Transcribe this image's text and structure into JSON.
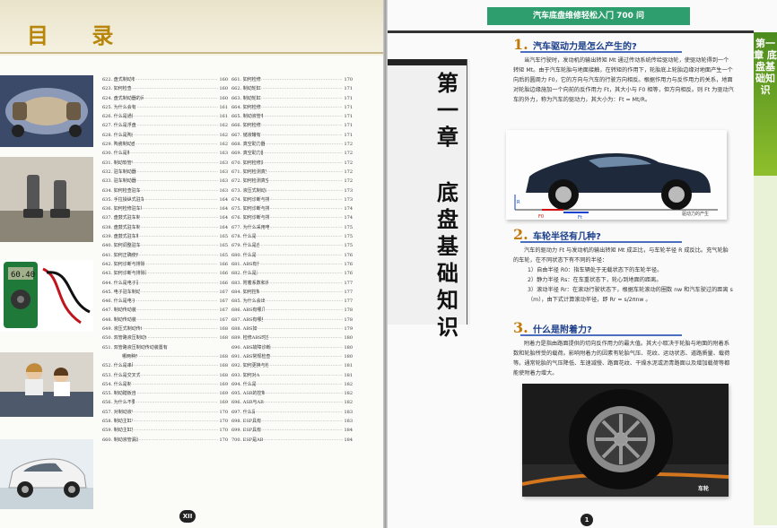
{
  "left_page": {
    "title": "目 录",
    "page_number": "XII",
    "toc_col1": [
      {
        "t": "622. 盘式制动有什么优点？",
        "p": "160"
      },
      {
        "t": "623. 如何检查制动盘？",
        "p": "160"
      },
      {
        "t": "624. 盘式制动器的间隙如何自动调整？",
        "p": "160"
      },
      {
        "t": "625. 为什么会有通风制动盘？",
        "p": "161"
      },
      {
        "t": "626. 什么是通风制动盘？",
        "p": "161"
      },
      {
        "t": "627. 什么是浮盘式制动系统？",
        "p": "162"
      },
      {
        "t": "628. 什么是陶瓷制动盘？",
        "p": "162"
      },
      {
        "t": "629. 陶瓷制动盘有何优势？",
        "p": "162"
      },
      {
        "t": "630. 什么是制动液？",
        "p": "163"
      },
      {
        "t": "631. 制动软管有何作用？",
        "p": "163"
      },
      {
        "t": "632. 驻车制动器有什么作用？",
        "p": "163"
      },
      {
        "t": "633. 驻车制动器有哪些类型？",
        "p": "163"
      },
      {
        "t": "634. 如何检查驻车制动器的性能？",
        "p": "163"
      },
      {
        "t": "635. 手拉操纵式驻车制动器如何工作？",
        "p": "164"
      },
      {
        "t": "636. 如何检修驻车制动器操纵装置？",
        "p": "164"
      },
      {
        "t": "637. 盘鼓式驻车制动器如何工作？",
        "p": "164"
      },
      {
        "t": "638. 盘鼓式驻车制动器如何工作？",
        "p": "164"
      },
      {
        "t": "639. 盘鼓式驻车制动器的结构？",
        "p": "165"
      },
      {
        "t": "640. 如何调整驻车制动器的行程？",
        "p": "165"
      },
      {
        "t": "641. 如何正确使用驻车制动器？",
        "p": "165"
      },
      {
        "t": "642. 如何诊断与排除驻车制动不良故障？",
        "p": "166"
      },
      {
        "t": "643. 如何诊断与排除驻车制动器拖滞故障？",
        "p": "166"
      },
      {
        "t": "644. 什么是电子驻车制动系统？",
        "p": "166"
      },
      {
        "t": "645. 电子驻车制动系统如何工作？",
        "p": "167"
      },
      {
        "t": "646. 什么是电子驻车系统？",
        "p": "167"
      },
      {
        "t": "647. 制动传动装置有何作用？",
        "p": "167"
      },
      {
        "t": "648. 制动传动装置如何分类？",
        "p": "167"
      },
      {
        "t": "649. 液压式制动传动装置有何特点？",
        "p": "168"
      },
      {
        "t": "650. 双管路液压制动传动装置有什么特点？",
        "p": "168"
      },
      {
        "t": "651. 双管路液压制动传动装置有",
        "p": "",
        "nopage": true
      },
      {
        "t": "哪两种形式？",
        "p": "168",
        "sub": true
      },
      {
        "t": "652. 什么是串联式主缸？",
        "p": "168"
      },
      {
        "t": "653. 什么是交叉式制动传动装置？",
        "p": "168"
      },
      {
        "t": "654. 什么是制动踏板？",
        "p": "169"
      },
      {
        "t": "655. 制动踏板自由行程多大？",
        "p": "169"
      },
      {
        "t": "656. 为什么不要空档滑行？",
        "p": "169"
      },
      {
        "t": "657. 对制动液有何要求？",
        "p": "170"
      },
      {
        "t": "658. 制动主缸有何作用？",
        "p": "170"
      },
      {
        "t": "659. 制动主缸如何工作？",
        "p": "170"
      },
      {
        "t": "660. 制动液管漏油时如何处理？",
        "p": "170"
      }
    ],
    "toc_col2": [
      {
        "t": "661. 如何检修制动主缸？",
        "p": "170"
      },
      {
        "t": "662. 制动轮缸有何作用？",
        "p": "171"
      },
      {
        "t": "663. 制动轮缸如何工作？",
        "p": "171"
      },
      {
        "t": "664. 如何检修制动轮缸？",
        "p": "171"
      },
      {
        "t": "665. 制动液管有几种类型？",
        "p": "171"
      },
      {
        "t": "666. 如何检修制动液管？",
        "p": "171"
      },
      {
        "t": "667. 储液罐有什么作用？",
        "p": "171"
      },
      {
        "t": "668. 真空助力器有什么作用？",
        "p": "172"
      },
      {
        "t": "669. 真空助力器怎样工作？",
        "p": "172"
      },
      {
        "t": "670. 如何检修真空助力器？",
        "p": "172"
      },
      {
        "t": "671. 如何检测真空助力器性能？",
        "p": "172"
      },
      {
        "t": "672. 如何检测真空助力器密封性？",
        "p": "172"
      },
      {
        "t": "673. 液压式制动系统如何排气？",
        "p": "173"
      },
      {
        "t": "674. 如何诊断与排除制动不良故障？",
        "p": "173"
      },
      {
        "t": "675. 如何诊断与排除制动跑偏故障？",
        "p": "174"
      },
      {
        "t": "676. 如何诊断与排除制动拖滞故障？",
        "p": "174"
      },
      {
        "t": "677. 为什么采用电动制动助力装置？",
        "p": "175"
      },
      {
        "t": "678. 什么是ABS？",
        "p": "175"
      },
      {
        "t": "679. 什么是自动驻车？",
        "p": "175"
      },
      {
        "t": "680. 什么是ABS？",
        "p": "176"
      },
      {
        "t": "681. ABS有什么优点？",
        "p": "176"
      },
      {
        "t": "682. 什么是滑移率？",
        "p": "176"
      },
      {
        "t": "683. 附着系数和滑移率有何关系？",
        "p": "177"
      },
      {
        "t": "684. 如何控制滑移率？",
        "p": "177"
      },
      {
        "t": "685. 为什么会出现滑移现象？",
        "p": "177"
      },
      {
        "t": "686. ABS有哪几种控制形式？",
        "p": "178"
      },
      {
        "t": "687. ABS有哪些生产厂家？",
        "p": "178"
      },
      {
        "t": "688. ABS如何工作？",
        "p": "179"
      },
      {
        "t": "689. 检修ABS时应注意哪些问题？",
        "p": "180"
      },
      {
        "t": "690. ABS故障诊断的一般程序是什么？",
        "p": "180"
      },
      {
        "t": "691. ABS常规检查包括哪几个方面？",
        "p": "180"
      },
      {
        "t": "692. 如何更换与检查ABS控制器？",
        "p": "181"
      },
      {
        "t": "693. 如何对ABS排气？",
        "p": "181"
      },
      {
        "t": "694. 什么是ASR？",
        "p": "182"
      },
      {
        "t": "695. ASR的控制方式有几种？",
        "p": "182"
      },
      {
        "t": "696. ASR与ABS有何异同？",
        "p": "182"
      },
      {
        "t": "697. 什么是ESP？",
        "p": "183"
      },
      {
        "t": "698. ESP具有哪些功能？",
        "p": "183"
      },
      {
        "t": "699. ESP具有哪些特点？",
        "p": "184"
      },
      {
        "t": "700. ESP是ABS的升级吗？",
        "p": "184"
      }
    ]
  },
  "right_page": {
    "header_band": "汽车底盘维修轻松入门 700 问",
    "chapter_no": "第一章",
    "chapter_name": "底盘基础知识",
    "side_tab": "第一章 底盘基础知识",
    "page_number": "1",
    "sections": [
      {
        "num": "1.",
        "title": "汽车驱动力是怎么产生的?",
        "paragraphs": [
          "当汽车行驶时，发动机的输出转矩 Mt 通过传动系统传给驱动轮，使驱动轮得到一个转矩 Mt。由于汽车轮胎与地面接触，在转矩的作用下，轮胎底上轮胎边缘对地面产生一个向后的圆周力 F0，它的方向与汽车的行驶方向相反。根据作用力与反作用力的关系，地面对轮胎边缘施加一个向前的反作用力 Ft，其大小与 F0 相等，但方向相反。则 Ft 为驱动汽车的外力，称为汽车的驱动力，其大小为：Ft = Mt/R。"
        ]
      },
      {
        "num": "2.",
        "title": "车轮半径有几种?",
        "paragraphs": [
          "汽车的驱动力 Ft 与发动机的输出转矩 Mt 成正比，与车轮半径 R 成反比。充气轮胎的车轮，在不同状态下有不同的半径：",
          "1）自由半径 R0：指车辆处于无载状态下的车轮半径。",
          "2）静力半径 Rs：在车重状态下，轮心到地面的距离。",
          "3）滚动半径 Rr：在滚动行驶状态下，根据车轮滚动的圈数 nw 和汽车驶过的距离 s（m），由下式计算滚动半径，即 Rr = s/2πnw 。"
        ]
      },
      {
        "num": "3.",
        "title": "什么是附着力?",
        "paragraphs": [
          "附着力是指由路面提供的切向反作用力的最大值。其大小取决于轮胎与地面的附着系数和轮胎所受的载荷。影响附着力的因素有轮胎气压、花纹、运动状态、道路质量、载荷等。通常轮胎的气压降低、车速减慢、路面花纹、干燥水泥或沥青路面以及增加载荷等都能使附着力增大。"
        ]
      }
    ],
    "car_figure_caption": "驱动力的产生",
    "tire_caption": "车轮",
    "car_figure_labels": [
      "F0",
      "Ft",
      "R"
    ]
  },
  "colors": {
    "band": "#2f9e6e",
    "side_tab": "#6aa62a",
    "section_title": "#1a3d8a",
    "section_num": "#c27a0a"
  }
}
